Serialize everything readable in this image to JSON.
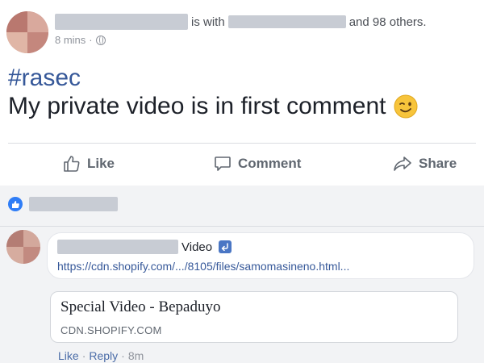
{
  "post": {
    "tagged_text": "is with",
    "others_text": "and 98 others.",
    "timestamp": "8 mins",
    "meta_sep": "·",
    "hashtag": "#rasec",
    "message": "My private video is in first comment",
    "actions": [
      {
        "label": "Like",
        "icon": "thumbs-up-icon"
      },
      {
        "label": "Comment",
        "icon": "speech-bubble-icon"
      },
      {
        "label": "Share",
        "icon": "share-arrow-icon"
      }
    ]
  },
  "comment": {
    "video_label": "Video",
    "link_text": "https://cdn.shopify.com/.../8105/files/samomasineno.html...",
    "preview_title": "Special Video - Bepaduyo",
    "preview_domain": "CDN.SHOPIFY.COM",
    "like_label": "Like",
    "reply_label": "Reply",
    "sep": "·",
    "time": "8m"
  },
  "colors": {
    "link": "#365899",
    "action_text": "#606770",
    "comments_bg": "#f2f3f5",
    "like_badge": "#2f7df6"
  }
}
